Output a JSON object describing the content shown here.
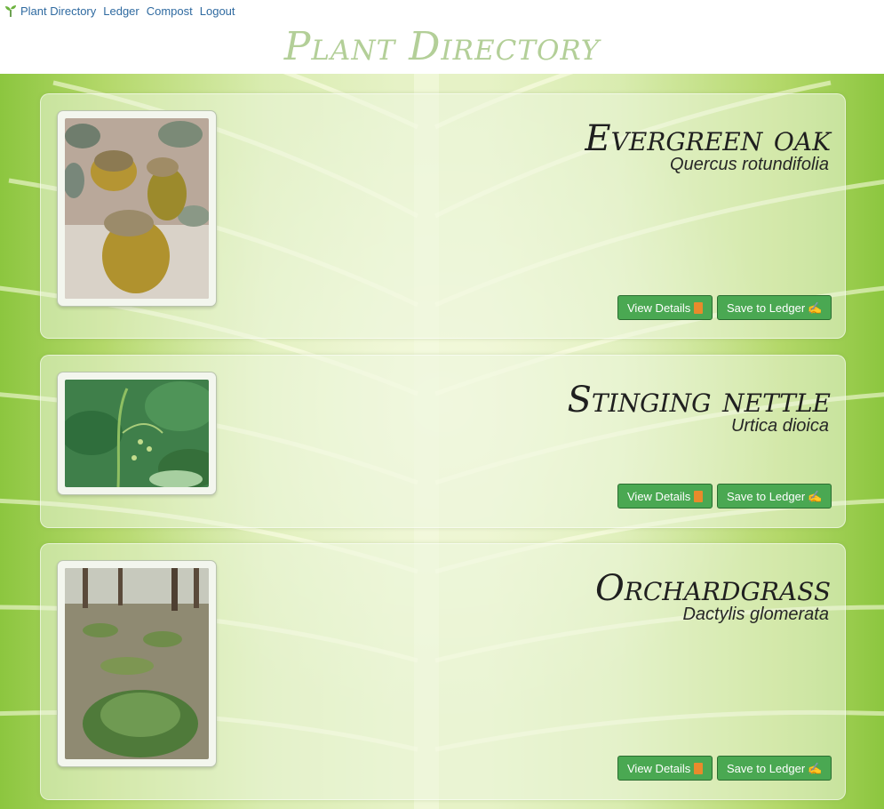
{
  "nav": {
    "links": [
      "Plant Directory",
      "Ledger",
      "Compost",
      "Logout"
    ]
  },
  "site_title": "Plant Directory",
  "plants": [
    {
      "common_name": "Evergreen oak",
      "scientific_name": "Quercus rotundifolia",
      "view_label": "View Details",
      "save_label": "Save to Ledger",
      "view_icon": "book-icon",
      "save_icon": "writing-hand-icon"
    },
    {
      "common_name": "Stinging nettle",
      "scientific_name": "Urtica dioica",
      "view_label": "View Details",
      "save_label": "Save to Ledger",
      "view_icon": "book-icon",
      "save_icon": "writing-hand-icon"
    },
    {
      "common_name": "Orchardgrass",
      "scientific_name": "Dactylis glomerata",
      "view_label": "View Details",
      "save_label": "Save to Ledger",
      "view_icon": "book-icon",
      "save_icon": "writing-hand-icon"
    }
  ],
  "colors": {
    "button": "#4aa852",
    "title": "#b3cf98",
    "link": "#2f6aa0"
  }
}
